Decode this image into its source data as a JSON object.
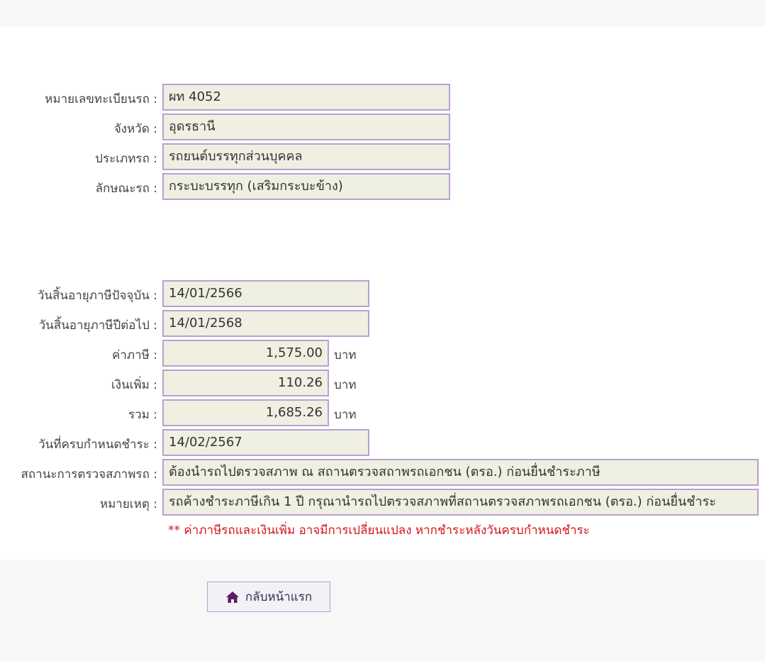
{
  "vehicle": {
    "plate_label": "หมายเลขทะเบียนรถ :",
    "plate_value": "ผท 4052",
    "province_label": "จังหวัด :",
    "province_value": "อุดรธานี",
    "type_label": "ประเภทรถ :",
    "type_value": "รถยนต์บรรทุกส่วนบุคคล",
    "style_label": "ลักษณะรถ :",
    "style_value": "กระบะบรรทุก (เสริมกระบะข้าง)"
  },
  "tax": {
    "current_expiry_label": "วันสิ้นอายุภาษีปัจจุบัน :",
    "current_expiry_value": "14/01/2566",
    "next_expiry_label": "วันสิ้นอายุภาษีปีต่อไป :",
    "next_expiry_value": "14/01/2568",
    "tax_label": "ค่าภาษี :",
    "tax_value": "1,575.00",
    "surcharge_label": "เงินเพิ่ม :",
    "surcharge_value": "110.26",
    "total_label": "รวม :",
    "total_value": "1,685.26",
    "currency_unit": "บาท",
    "due_date_label": "วันที่ครบกำหนดชำระ :",
    "due_date_value": "14/02/2567",
    "inspection_label": "สถานะการตรวจสภาพรถ :",
    "inspection_value": "ต้องนำรถไปตรวจสภาพ ณ สถานตรวจสถาพรถเอกชน (ตรอ.) ก่อนยื่นชำระภาษี",
    "remark_label": "หมายเหตุ :",
    "remark_value": "รถค้างชำระภาษีเกิน 1 ปี กรุณานำรถไปตรวจสภาพที่สถานตรวจสภาพรถเอกชน (ตรอ.) ก่อนยื่นชำระ",
    "note": "** ค่าภาษีรถและเงินเพิ่ม อาจมีการเปลี่ยนแปลง หากชำระหลังวันครบกำหนดชำระ"
  },
  "actions": {
    "home_label": "กลับหน้าแรก",
    "home_icon": "home-icon"
  },
  "colors": {
    "field_bg": "#efefe2",
    "field_border": "#b9a0cf",
    "note_text": "#d4141b",
    "icon": "#5b1e63"
  }
}
